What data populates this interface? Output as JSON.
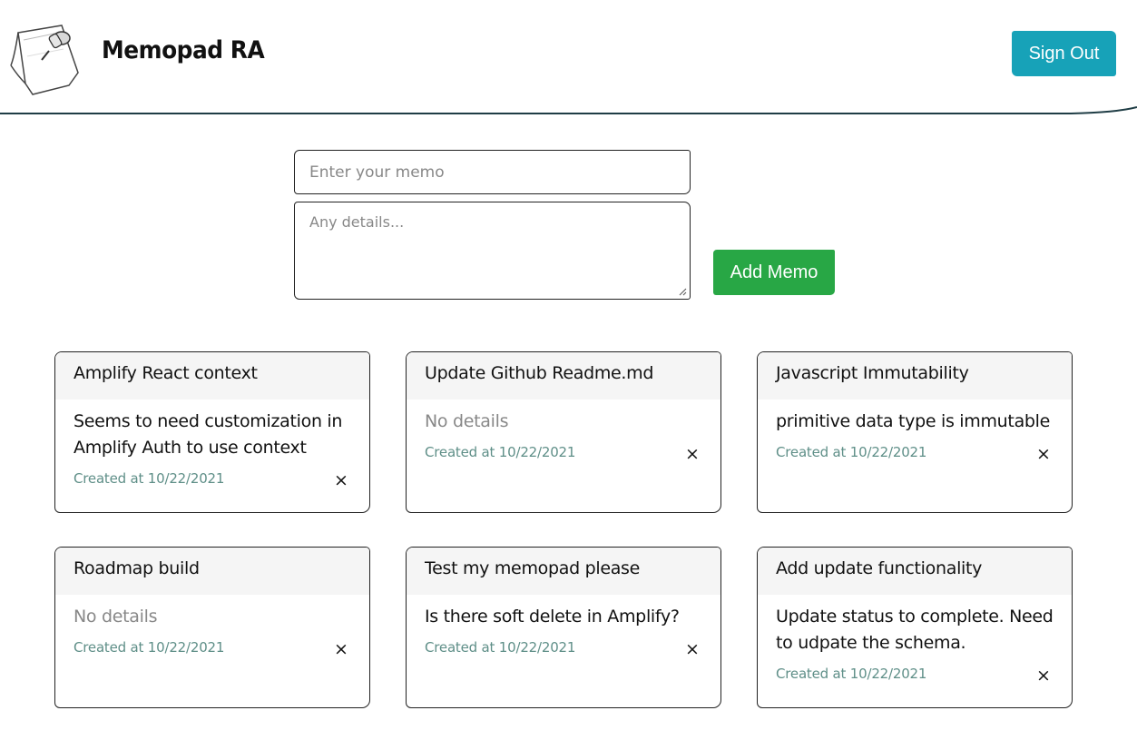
{
  "header": {
    "title": "Memopad RA",
    "signout_label": "Sign Out",
    "logo_icon": "pinned-note-icon"
  },
  "form": {
    "memo_placeholder": "Enter your memo",
    "details_placeholder": "Any details...",
    "add_label": "Add Memo"
  },
  "colors": {
    "signout": "#17a2b8",
    "add": "#28a745",
    "created_text": "#5f8f88"
  },
  "memos": [
    {
      "title": "Amplify React context",
      "details": "Seems to need customization in Amplify Auth to use context",
      "created": "Created at 10/22/2021",
      "delete": "×"
    },
    {
      "title": "Update Github Readme.md",
      "details": "No details",
      "created": "Created at 10/22/2021",
      "delete": "×"
    },
    {
      "title": "Javascript Immutability",
      "details": "primitive data type is immutable",
      "created": "Created at 10/22/2021",
      "delete": "×"
    },
    {
      "title": "Roadmap build",
      "details": "No details",
      "created": "Created at 10/22/2021",
      "delete": "×"
    },
    {
      "title": "Test my memopad please",
      "details": "Is there soft delete in Amplify?",
      "created": "Created at 10/22/2021",
      "delete": "×"
    },
    {
      "title": "Add update functionality",
      "details": "Update status to complete. Need to udpate the schema.",
      "created": "Created at 10/22/2021",
      "delete": "×"
    }
  ]
}
